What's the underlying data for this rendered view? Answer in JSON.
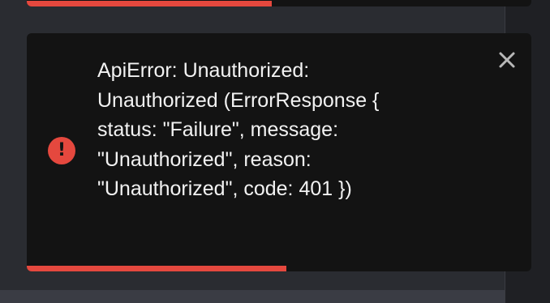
{
  "toast": {
    "message_lines": [
      "ApiError: Unauthorized:",
      "Unauthorized (ErrorResponse {",
      "status: \"Failure\", message:",
      "\"Unauthorized\", reason:",
      "\"Unauthorized\", code: 401 })"
    ],
    "icon": "error-icon",
    "icon_glyph": "!",
    "close_icon": "close-icon",
    "close_glyph": "×"
  },
  "colors": {
    "toast_background": "#131313",
    "progress_bar": "#e5483e",
    "error_icon": "#e5483e",
    "text": "#f2f2f2",
    "close_icon": "#b8b8b8"
  }
}
